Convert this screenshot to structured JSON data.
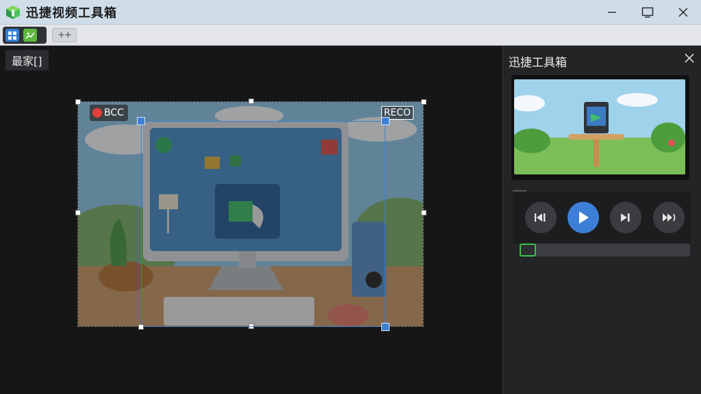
{
  "app": {
    "title": "迅捷视频工具箱"
  },
  "window_controls": [
    "minimize",
    "maximize",
    "close"
  ],
  "tabs": {
    "add_label": "++"
  },
  "workspace": {
    "chip_label": "最家[]",
    "badges": {
      "left": "BCC",
      "right": "RECO"
    }
  },
  "panel": {
    "title": "迅捷工具箱",
    "controls": [
      "rewind-icon",
      "play-icon",
      "next-frame-icon",
      "fast-forward-icon"
    ],
    "progress": 0
  },
  "colors": {
    "accent": "#3d7fd6",
    "slider_knob": "#3ec24a",
    "rec": "#e43f3a"
  }
}
